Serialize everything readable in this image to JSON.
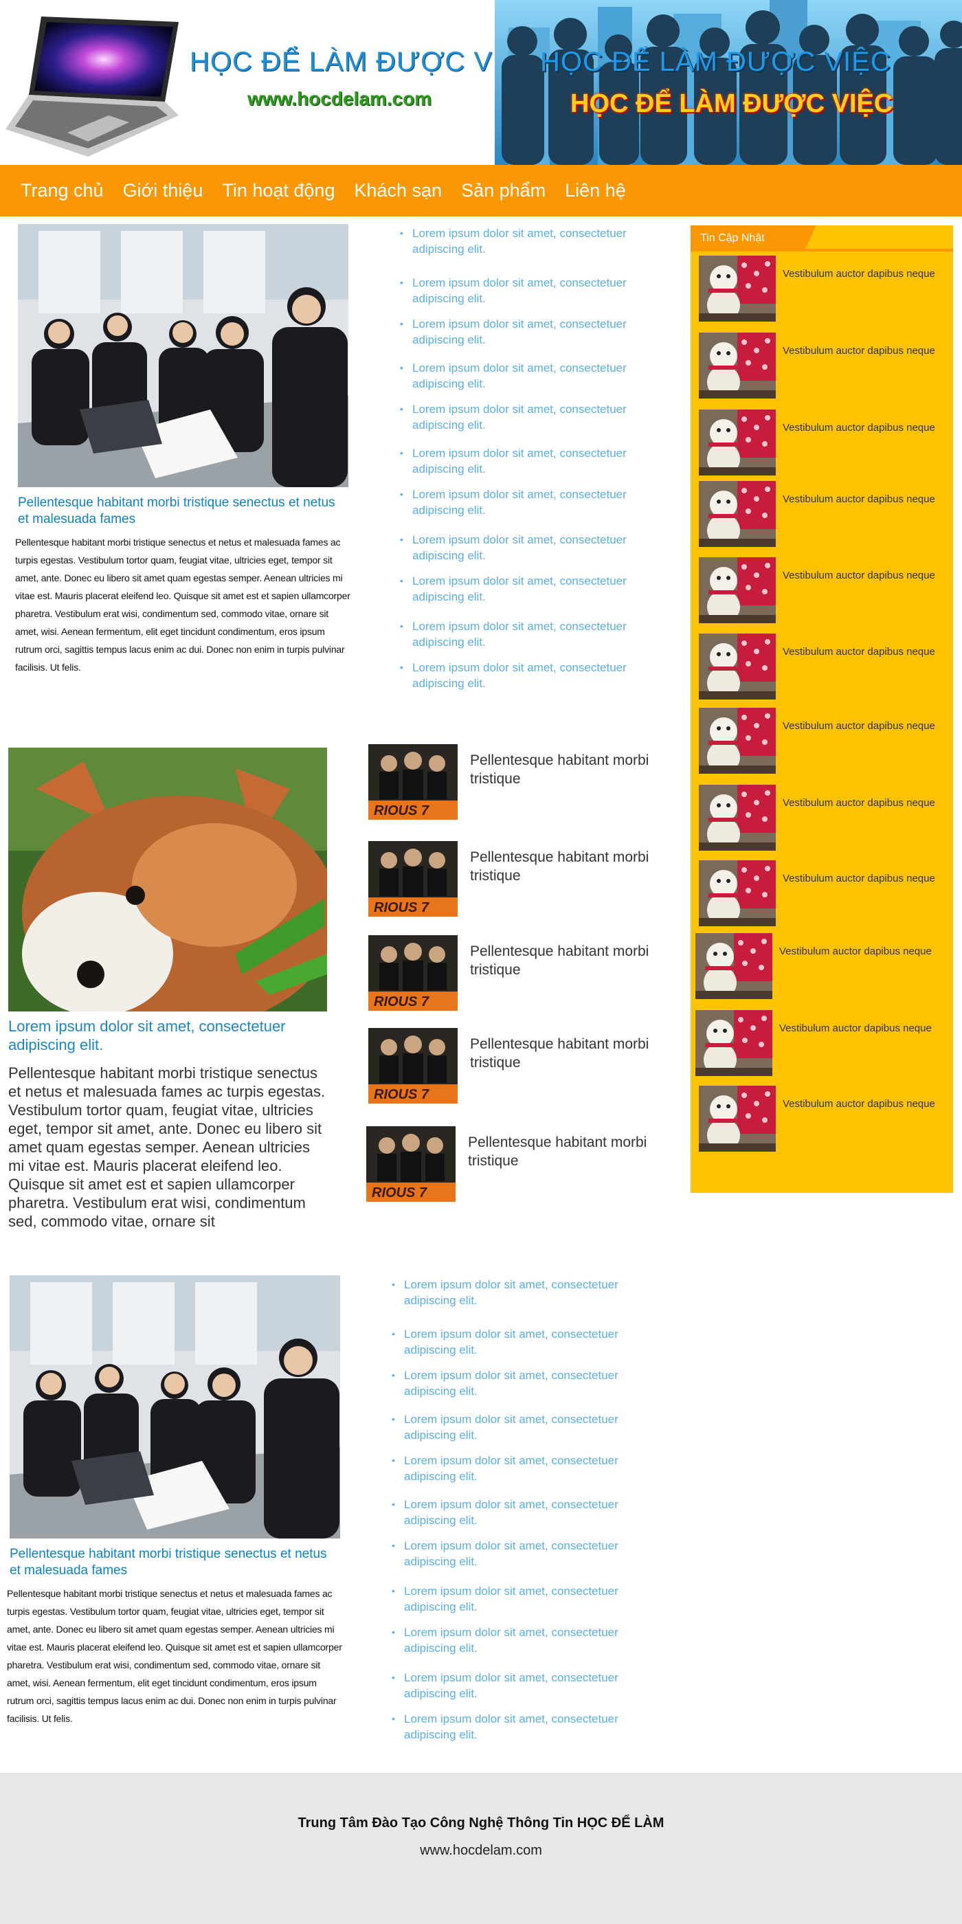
{
  "header": {
    "site_title": "HỌC ĐỂ LÀM ĐƯỢC VIỆC",
    "site_url": "www.hocdelam.com",
    "banner_title_blue": "HỌC ĐỂ LÀM ĐƯỢC VIỆC",
    "banner_title_fire": "HỌC ĐỂ LÀM ĐƯỢC VIỆC"
  },
  "nav": {
    "items": [
      "Trang chủ",
      "Giới thiệu",
      "Tin hoạt động",
      "Khách sạn",
      "Sản phẩm",
      "Liên hệ"
    ]
  },
  "section1": {
    "caption": "Pellentesque habitant morbi tristique senectus et netus et malesuada fames",
    "body": "Pellentesque habitant morbi tristique senectus et netus et malesuada fames ac turpis egestas. Vestibulum tortor quam, feugiat vitae, ultricies eget, tempor sit amet, ante. Donec eu libero sit amet quam egestas semper. Aenean ultricies mi vitae est. Mauris placerat eleifend leo. Quisque sit amet est et sapien ullamcorper pharetra. Vestibulum erat wisi, condimentum sed, commodo vitae, ornare sit amet, wisi. Aenean fermentum, elit eget tincidunt condimentum, eros ipsum rutrum orci, sagittis tempus lacus enim ac dui. Donec non enim in turpis pulvinar facilisis. Ut felis.",
    "links": [
      "Lorem ipsum dolor sit amet, consectetuer adipiscing elit.",
      "Lorem ipsum dolor sit amet, consectetuer adipiscing elit.",
      "Lorem ipsum dolor sit amet, consectetuer adipiscing elit.",
      "Lorem ipsum dolor sit amet, consectetuer adipiscing elit.",
      "Lorem ipsum dolor sit amet, consectetuer adipiscing elit.",
      "Lorem ipsum dolor sit amet, consectetuer adipiscing elit.",
      "Lorem ipsum dolor sit amet, consectetuer adipiscing elit.",
      "Lorem ipsum dolor sit amet, consectetuer adipiscing elit.",
      "Lorem ipsum dolor sit amet, consectetuer adipiscing elit.",
      "Lorem ipsum dolor sit amet, consectetuer adipiscing elit.",
      "Lorem ipsum dolor sit amet, consectetuer adipiscing elit."
    ]
  },
  "section2": {
    "caption": "Lorem ipsum dolor sit amet, consectetuer adipiscing elit.",
    "body": "Pellentesque habitant morbi tristique senectus et netus et malesuada fames ac turpis egestas. Vestibulum tortor quam, feugiat vitae, ultricies eget, tempor sit amet, ante. Donec eu libero sit amet quam egestas semper. Aenean ultricies mi vitae est. Mauris placerat eleifend leo. Quisque sit amet est et sapien ullamcorper pharetra. Vestibulum erat wisi, condimentum sed, commodo vitae, ornare sit",
    "movies": [
      "Pellentesque habitant morbi tristique",
      "Pellentesque habitant morbi tristique",
      "Pellentesque habitant morbi tristique",
      "Pellentesque habitant morbi tristique",
      "Pellentesque habitant morbi tristique"
    ]
  },
  "section3": {
    "caption": "Pellentesque habitant morbi tristique senectus et netus et malesuada fames",
    "body": "Pellentesque habitant morbi tristique senectus et netus et malesuada fames ac turpis egestas. Vestibulum tortor quam, feugiat vitae, ultricies eget, tempor sit amet, ante. Donec eu libero sit amet quam egestas semper. Aenean ultricies mi vitae est. Mauris placerat eleifend leo. Quisque sit amet est et sapien ullamcorper pharetra. Vestibulum erat wisi, condimentum sed, commodo vitae, ornare sit amet, wisi. Aenean fermentum, elit eget tincidunt condimentum, eros ipsum rutrum orci, sagittis tempus lacus enim ac dui. Donec non enim in turpis pulvinar facilisis. Ut felis.",
    "links": [
      "Lorem ipsum dolor sit amet, consectetuer adipiscing elit.",
      "Lorem ipsum dolor sit amet, consectetuer adipiscing elit.",
      "Lorem ipsum dolor sit amet, consectetuer adipiscing elit.",
      "Lorem ipsum dolor sit amet, consectetuer adipiscing elit.",
      "Lorem ipsum dolor sit amet, consectetuer adipiscing elit.",
      "Lorem ipsum dolor sit amet, consectetuer adipiscing elit.",
      "Lorem ipsum dolor sit amet, consectetuer adipiscing elit.",
      "Lorem ipsum dolor sit amet, consectetuer adipiscing elit.",
      "Lorem ipsum dolor sit amet, consectetuer adipiscing elit.",
      "Lorem ipsum dolor sit amet, consectetuer adipiscing elit.",
      "Lorem ipsum dolor sit amet, consectetuer adipiscing elit."
    ]
  },
  "sidebar": {
    "title": "Tin Cập Nhật",
    "items": [
      "Vestibulum auctor dapibus neque",
      "Vestibulum auctor dapibus neque",
      "Vestibulum auctor dapibus neque",
      "Vestibulum auctor dapibus neque",
      "Vestibulum auctor dapibus neque",
      "Vestibulum auctor dapibus neque",
      "Vestibulum auctor dapibus neque",
      "Vestibulum auctor dapibus neque",
      "Vestibulum auctor dapibus neque",
      "Vestibulum auctor dapibus neque",
      "Vestibulum auctor dapibus neque",
      "Vestibulum auctor dapibus neque"
    ]
  },
  "footer": {
    "title": "Trung Tâm Đào Tạo Công Nghệ Thông Tin HỌC ĐỂ LÀM",
    "url": "www.hocdelam.com"
  },
  "colors": {
    "nav_bg": "#fb9703",
    "sidebar_bg": "#fdc201",
    "link_blue": "#5aaee6",
    "caption_blue": "#0b82c4",
    "footer_bg": "#e7e7e7"
  }
}
